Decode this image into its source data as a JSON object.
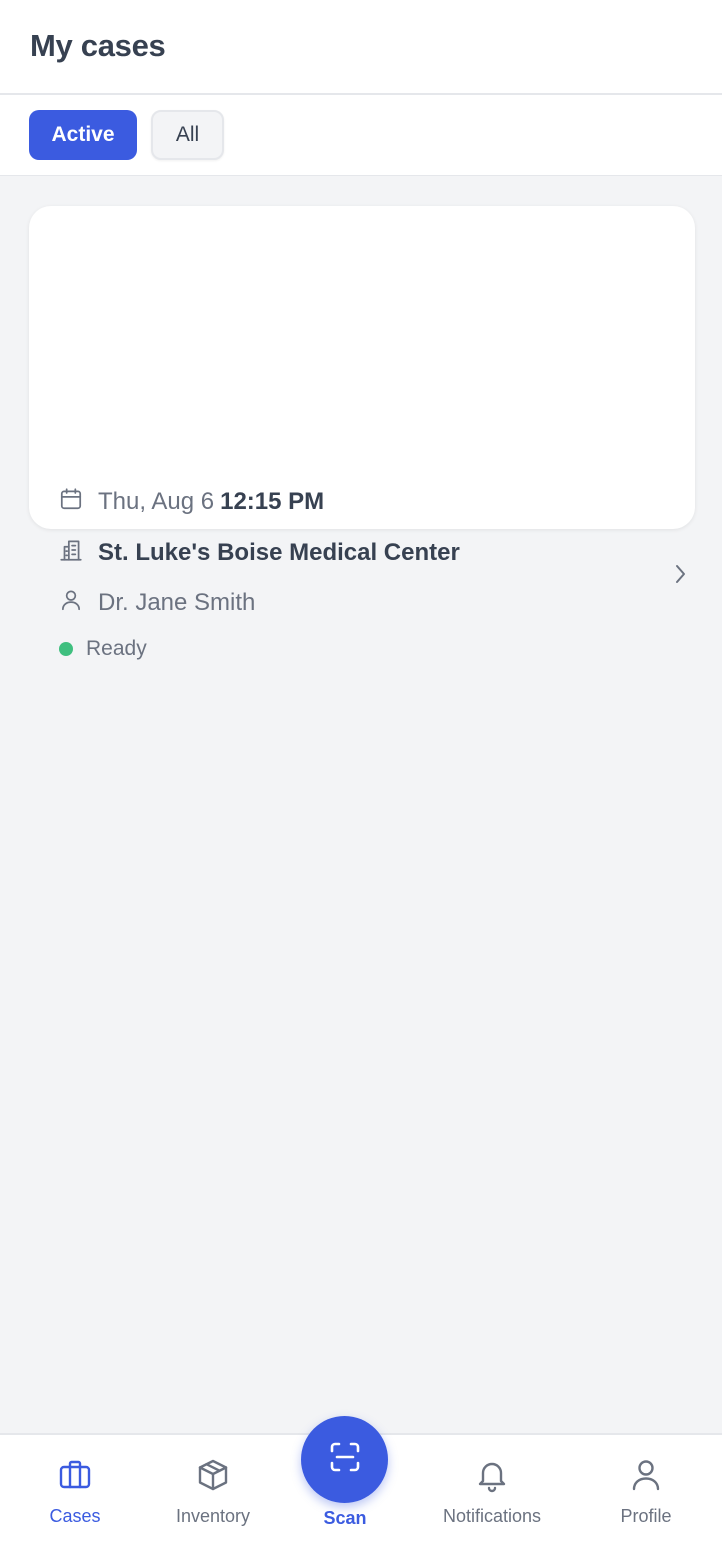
{
  "header": {
    "title": "My cases"
  },
  "filters": {
    "active_label": "Active",
    "all_label": "All",
    "selected": "Active"
  },
  "cases": [
    {
      "date": "Thu, Aug 6",
      "time": "12:15 PM",
      "hospital": "St. Luke's Boise Medical Center",
      "doctor": "Dr. Jane Smith",
      "status": "Ready",
      "status_color": "#3fbf7f"
    }
  ],
  "nav": {
    "cases": "Cases",
    "inventory": "Inventory",
    "scan": "Scan",
    "notifications": "Notifications",
    "profile": "Profile",
    "active": "Cases"
  },
  "colors": {
    "accent": "#3b5be0",
    "background": "#f3f4f6",
    "card": "#ffffff",
    "text_muted": "#6b7280",
    "text_strong": "#374151"
  },
  "icons": {
    "date": "calendar-icon",
    "hospital": "building-icon",
    "doctor": "user-icon",
    "card_action": "chevron-right-icon",
    "nav_cases": "briefcase-icon",
    "nav_inventory": "box-icon",
    "nav_scan": "scan-icon",
    "nav_notifications": "bell-icon",
    "nav_profile": "user-icon"
  }
}
